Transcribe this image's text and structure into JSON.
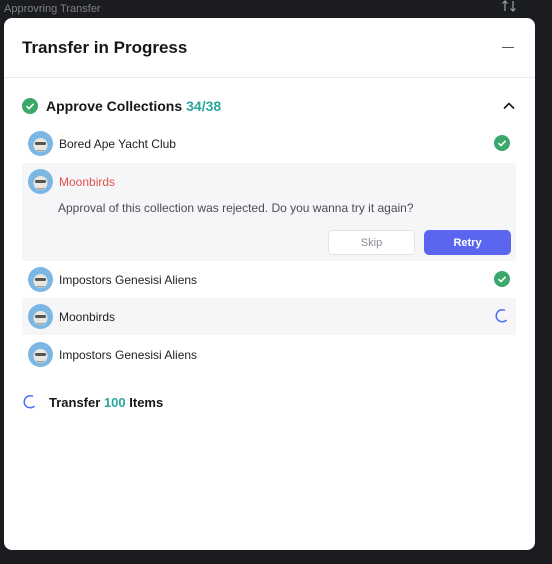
{
  "window": {
    "title": "Approvring Transfer"
  },
  "panel": {
    "title": "Transfer in Progress"
  },
  "section": {
    "title": "Approve Collections",
    "count": "34/38"
  },
  "collections": [
    {
      "name": "Bored Ape Yacht Club",
      "status": "approved"
    },
    {
      "name": "Moonbirds",
      "status": "rejected"
    },
    {
      "name": "Impostors Genesisi Aliens",
      "status": "approved"
    },
    {
      "name": "Moonbirds",
      "status": "pending"
    },
    {
      "name": "Impostors Genesisi Aliens",
      "status": "queued"
    }
  ],
  "rejection": {
    "message": "Approval of this collection was rejected. Do you wanna try it again?",
    "skip_label": "Skip",
    "retry_label": "Retry"
  },
  "transfer": {
    "prefix": "Transfer",
    "count": "100",
    "suffix": "Items"
  },
  "colors": {
    "accent": "#5b66f0",
    "success": "#3aa86b",
    "count_teal": "#2aa79b",
    "error": "#e0524e",
    "spinner": "#4a6cf7"
  }
}
